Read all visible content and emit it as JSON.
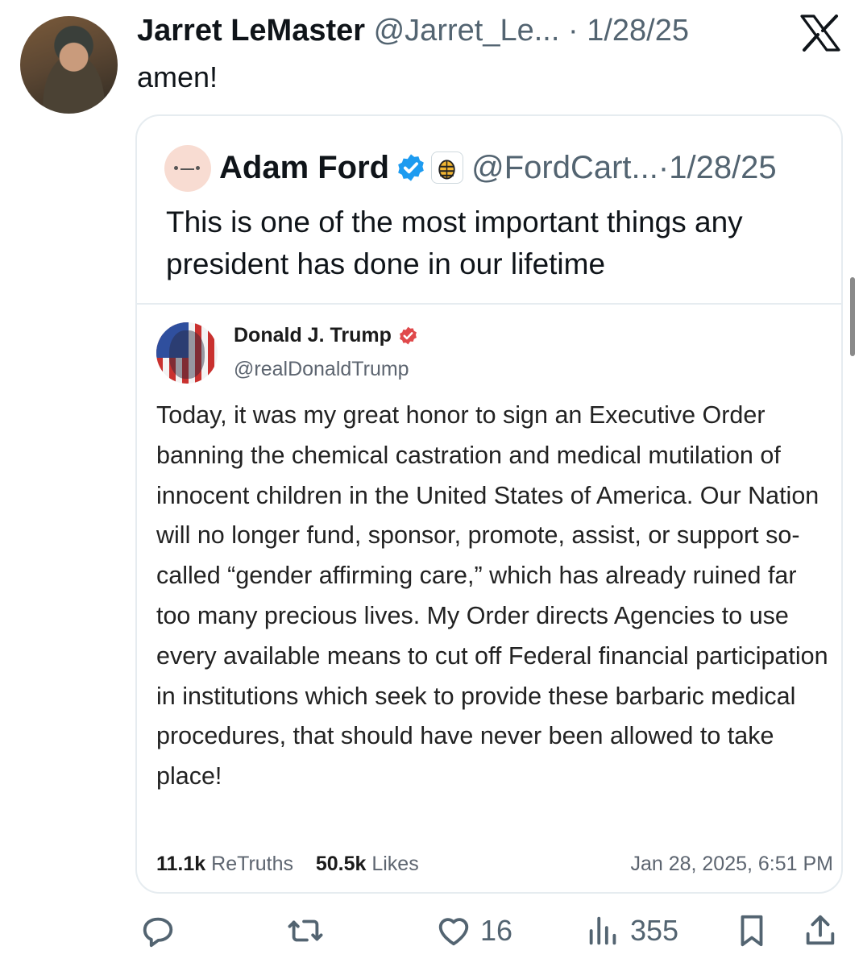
{
  "tweet": {
    "author_name": "Jarret LeMaster",
    "handle": "@Jarret_Le...",
    "date": "1/28/25",
    "separator": "·",
    "text": "amen!"
  },
  "quote": {
    "author_name": "Adam Ford",
    "handle": "@FordCart...",
    "date": "1/28/25",
    "separator": "·",
    "text": "This is one of the most important things any president has done in our lifetime"
  },
  "truth_post": {
    "author_name": "Donald J. Trump",
    "handle": "@realDonaldTrump",
    "body": "Today, it was my great honor to sign an Executive Order banning the chemical castration and medical mutilation of innocent children in the United States of America. Our Nation will no longer fund, sponsor, promote, assist, or support so-called “gender affirming care,” which has already ruined far too many precious lives. My Order directs Agencies to use every available means to cut off Federal financial participation in institutions which seek to provide these barbaric medical procedures, that should have never been allowed to take place!",
    "retruths_count": "11.1k",
    "retruths_label": "ReTruths",
    "likes_count": "50.5k",
    "likes_label": "Likes",
    "timestamp": "Jan 28, 2025, 6:51 PM"
  },
  "actions": {
    "likes": "16",
    "views": "355"
  },
  "icons": [
    "x-logo-icon",
    "verified-badge-icon",
    "babylon-bee-icon",
    "truth-verified-icon",
    "reply-icon",
    "retweet-icon",
    "like-icon",
    "views-icon",
    "bookmark-icon",
    "share-icon"
  ],
  "colors": {
    "verified_blue": "#1d9bf0",
    "secondary_text": "#536471",
    "truth_badge": "#e0494b"
  }
}
